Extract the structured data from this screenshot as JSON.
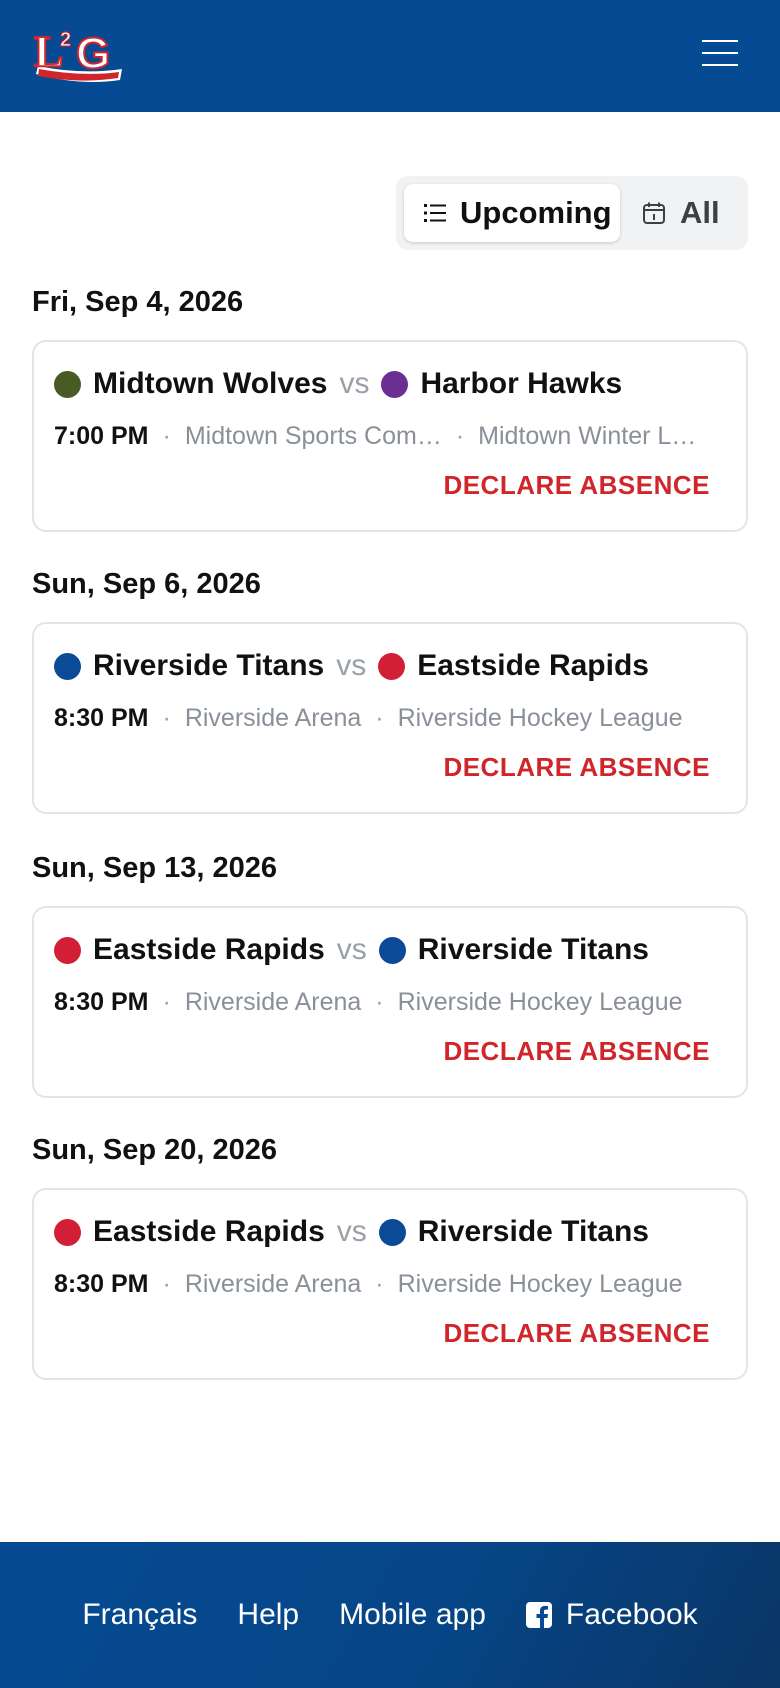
{
  "header": {
    "logo_text": "L2G",
    "menu_icon": "hamburger-menu-icon",
    "brand_color": "#054a93"
  },
  "filter": {
    "upcoming_label": "Upcoming",
    "all_label": "All",
    "selected": "Upcoming",
    "upcoming_icon": "list-icon",
    "all_icon": "calendar-icon"
  },
  "games": [
    {
      "date": "Fri, Sep 4, 2026",
      "home": {
        "name": "Midtown Wolves",
        "color": "#4a5a24"
      },
      "vs": "vs",
      "away": {
        "name": "Harbor Hawks",
        "color": "#6b2f94"
      },
      "time": "7:00 PM",
      "venue": "Midtown Sports Com…",
      "league": "Midtown Winter L…",
      "action": "DECLARE ABSENCE"
    },
    {
      "date": "Sun, Sep 6, 2026",
      "home": {
        "name": "Riverside Titans",
        "color": "#0b4a96"
      },
      "vs": "vs",
      "away": {
        "name": "Eastside Rapids",
        "color": "#d21f35"
      },
      "time": "8:30 PM",
      "venue": "Riverside Arena",
      "league": "Riverside Hockey League",
      "action": "DECLARE ABSENCE"
    },
    {
      "date": "Sun, Sep 13, 2026",
      "home": {
        "name": "Eastside Rapids",
        "color": "#d21f35"
      },
      "vs": "vs",
      "away": {
        "name": "Riverside Titans",
        "color": "#0b4a96"
      },
      "time": "8:30 PM",
      "venue": "Riverside Arena",
      "league": "Riverside Hockey League",
      "action": "DECLARE ABSENCE"
    },
    {
      "date": "Sun, Sep 20, 2026",
      "home": {
        "name": "Eastside Rapids",
        "color": "#d21f35"
      },
      "vs": "vs",
      "away": {
        "name": "Riverside Titans",
        "color": "#0b4a96"
      },
      "time": "8:30 PM",
      "venue": "Riverside Arena",
      "league": "Riverside Hockey League",
      "action": "DECLARE ABSENCE"
    }
  ],
  "meta_separator": "·",
  "footer": {
    "links": [
      "Français",
      "Help",
      "Mobile app",
      "Facebook"
    ],
    "facebook_icon": "facebook-icon",
    "action_color": "#d0262b"
  }
}
